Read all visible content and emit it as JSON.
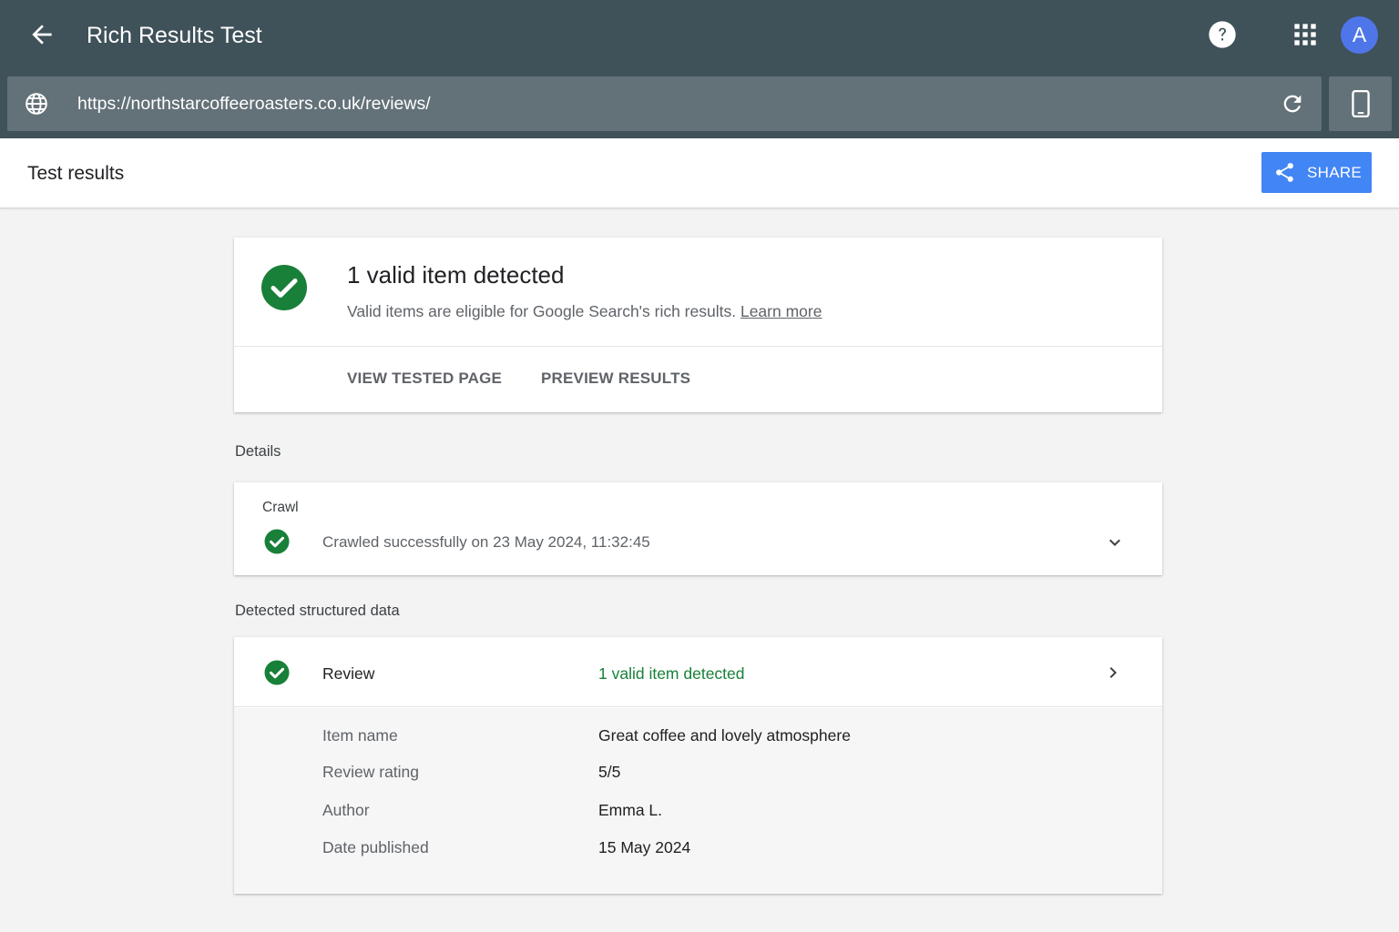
{
  "app": {
    "title": "Rich Results Test",
    "avatar_initial": "A",
    "colors": {
      "appbar": "#3f5159",
      "url_field": "#637178",
      "accent": "#4285f4",
      "success": "#188038",
      "avatar": "#4e76e8"
    },
    "icons": [
      "back-arrow-icon",
      "help-icon",
      "apps-grid-icon",
      "globe-icon",
      "refresh-icon",
      "smartphone-icon",
      "share-icon",
      "check-circle-icon",
      "chevron-down-icon",
      "chevron-right-icon"
    ]
  },
  "urlbar": {
    "url": "https://northstarcoffeeroasters.co.uk/reviews/"
  },
  "header": {
    "title": "Test results",
    "share_label": "SHARE"
  },
  "summary": {
    "heading": "1 valid item detected",
    "description": "Valid items are eligible for Google Search's rich results.",
    "learn_more": "Learn more",
    "actions": {
      "view_tested_page": "VIEW TESTED PAGE",
      "preview_results": "PREVIEW RESULTS"
    }
  },
  "details": {
    "section_label": "Details",
    "crawl": {
      "label": "Crawl",
      "status": "Crawled successfully on 23 May 2024, 11:32:45"
    }
  },
  "structured": {
    "section_label": "Detected structured data",
    "items": [
      {
        "type": "Review",
        "status": "1 valid item detected",
        "properties": [
          {
            "name": "Item name",
            "value": "Great coffee and lovely atmosphere"
          },
          {
            "name": "Review rating",
            "value": "5/5"
          },
          {
            "name": "Author",
            "value": "Emma L."
          },
          {
            "name": "Date published",
            "value": "15 May 2024"
          }
        ]
      }
    ]
  }
}
